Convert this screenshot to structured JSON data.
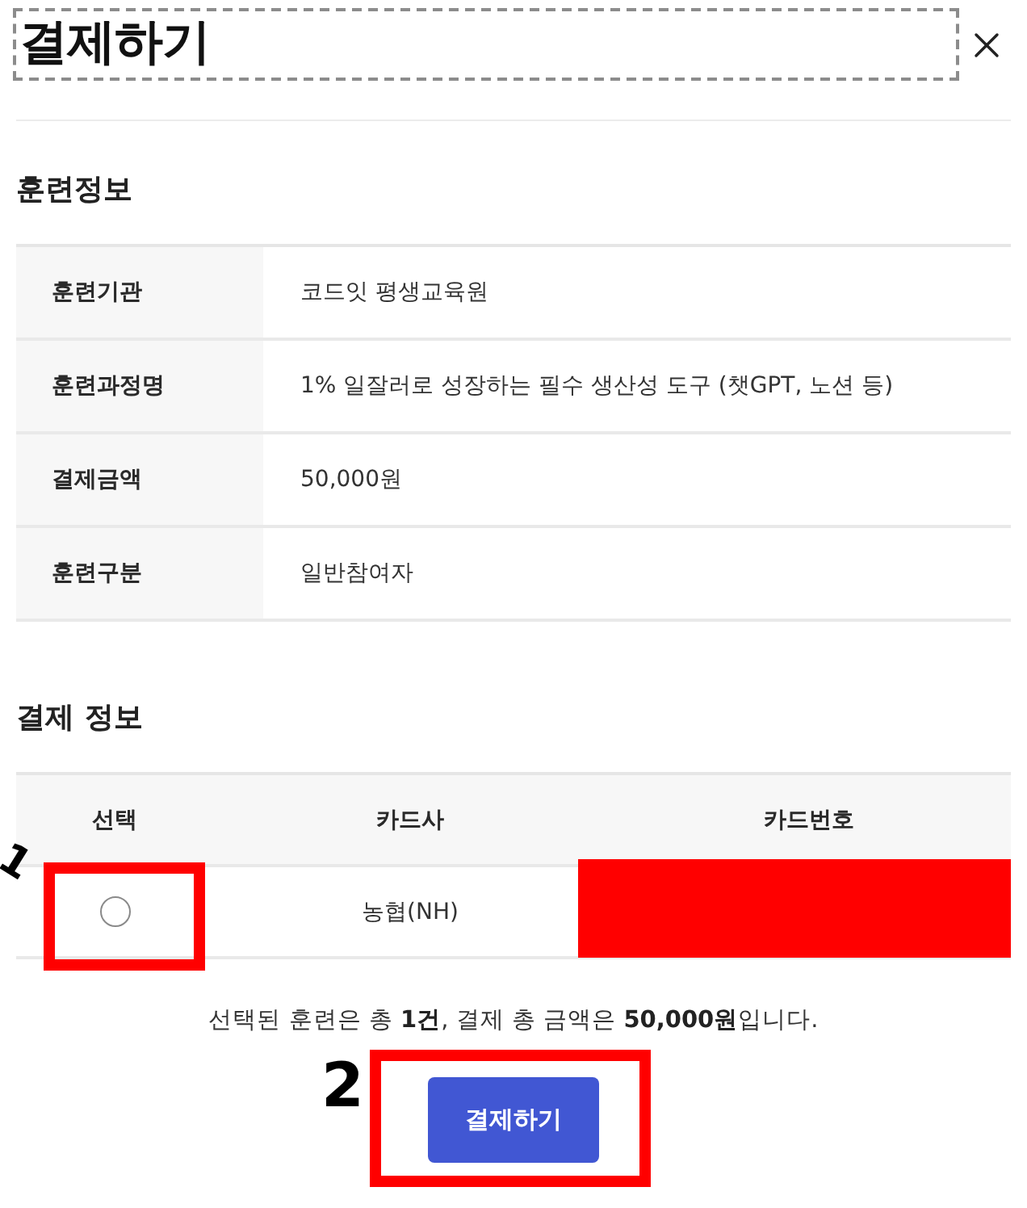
{
  "dialog": {
    "title": "결제하기",
    "focused": true
  },
  "training_info": {
    "heading": "훈련정보",
    "rows": [
      {
        "label": "훈련기관",
        "value": "코드잇 평생교육원"
      },
      {
        "label": "훈련과정명",
        "value": "1% 일잘러로 성장하는 필수 생산성 도구 (챗GPT, 노션 등)"
      },
      {
        "label": "결제금액",
        "value": "50,000원"
      },
      {
        "label": "훈련구분",
        "value": "일반참여자"
      }
    ]
  },
  "payment_info": {
    "heading": "결제 정보",
    "columns": [
      "선택",
      "카드사",
      "카드번호"
    ],
    "rows": [
      {
        "selected": false,
        "card_company": "농협(NH)",
        "card_number_redacted": true
      }
    ]
  },
  "summary": "선택된 훈련은 총 **1건**, 결제 총 금액은 **50,000원**입니다.",
  "pay_button": {
    "label": "결제하기"
  },
  "annotations": [
    {
      "label": "1",
      "kind": "radio"
    },
    {
      "label": "2",
      "kind": "button"
    }
  ]
}
